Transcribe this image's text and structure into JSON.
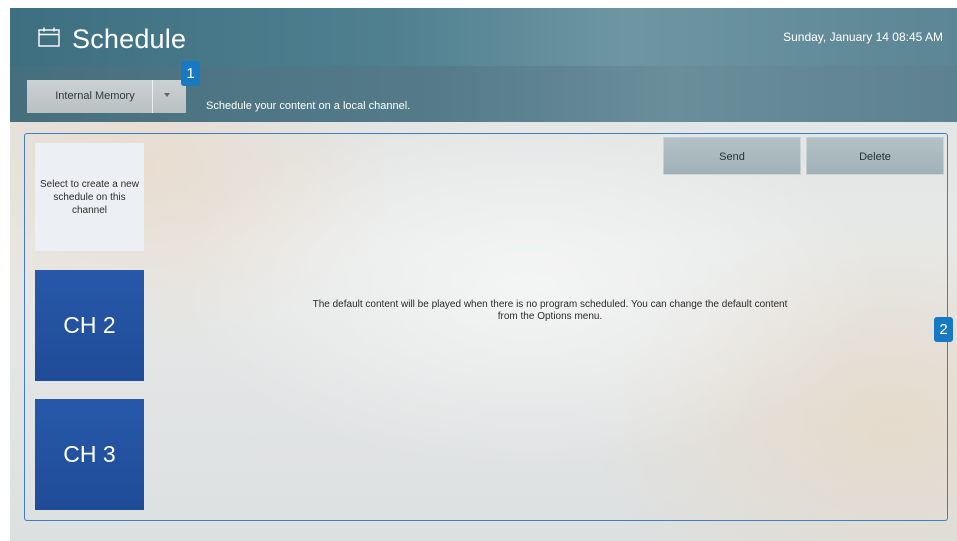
{
  "header": {
    "title": "Schedule",
    "icon": "calendar-icon",
    "datetime": "Sunday, January 14 08:45 AM"
  },
  "toolbar": {
    "storage": {
      "selected": "Internal Memory",
      "arrow_icon": "dropdown-arrow-icon"
    },
    "description": "Schedule your content on a local channel.",
    "send_label": "Send",
    "delete_label": "Delete"
  },
  "callouts": {
    "one": "1",
    "two": "2"
  },
  "channels": {
    "new_schedule_text": "Select to create a new schedule on this channel",
    "items": [
      {
        "label": "CH 2"
      },
      {
        "label": "CH 3"
      }
    ]
  },
  "main": {
    "default_message_line1": "The default content will be played when there is no program scheduled. You can change the default content",
    "default_message_line2": "from the Options menu."
  },
  "colors": {
    "accent": "#1779c4",
    "channel_tile": "#2356a6",
    "panel_border": "#3e7fc0"
  }
}
